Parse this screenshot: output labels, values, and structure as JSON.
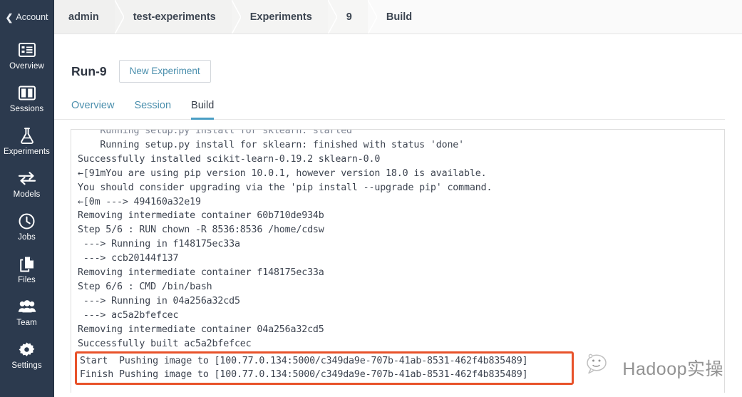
{
  "colors": {
    "sidebar_bg": "#2c3a4e",
    "accent_link": "#4b8fad",
    "tab_active_underline": "#4a9ec4",
    "highlight_box": "#e8522a",
    "text_primary": "#3d4450",
    "panel_border": "#dddddd"
  },
  "sidebar": {
    "account": {
      "label": "Account",
      "back_icon": "chevron-left-icon"
    },
    "items": [
      {
        "label": "Overview",
        "icon": "list-overview-icon"
      },
      {
        "label": "Sessions",
        "icon": "columns-sessions-icon"
      },
      {
        "label": "Experiments",
        "icon": "flask-experiments-icon"
      },
      {
        "label": "Models",
        "icon": "arrows-exchange-models-icon"
      },
      {
        "label": "Jobs",
        "icon": "clock-jobs-icon"
      },
      {
        "label": "Files",
        "icon": "copy-files-icon"
      },
      {
        "label": "Team",
        "icon": "people-team-icon"
      },
      {
        "label": "Settings",
        "icon": "gear-settings-icon"
      }
    ]
  },
  "breadcrumb": {
    "items": [
      {
        "label": "admin"
      },
      {
        "label": "test-experiments"
      },
      {
        "label": "Experiments"
      },
      {
        "label": "9"
      },
      {
        "label": "Build"
      }
    ]
  },
  "main": {
    "run_title": "Run-9",
    "new_experiment_button": "New Experiment",
    "tabs": [
      {
        "label": "Overview",
        "active": false
      },
      {
        "label": "Session",
        "active": false
      },
      {
        "label": "Build",
        "active": true
      }
    ]
  },
  "build_log": {
    "clipped_top_line": "    Running setup.py install for sklearn: started",
    "lines": [
      "    Running setup.py install for sklearn: finished with status 'done'",
      "Successfully installed scikit-learn-0.19.2 sklearn-0.0",
      "←[91mYou are using pip version 10.0.1, however version 18.0 is available.",
      "You should consider upgrading via the 'pip install --upgrade pip' command.",
      "←[0m ---> 494160a32e19",
      "Removing intermediate container 60b710de934b",
      "Step 5/6 : RUN chown -R 8536:8536 /home/cdsw",
      " ---> Running in f148175ec33a",
      " ---> ccb20144f137",
      "Removing intermediate container f148175ec33a",
      "Step 6/6 : CMD /bin/bash",
      " ---> Running in 04a256a32cd5",
      " ---> ac5a2bfefcec",
      "Removing intermediate container 04a256a32cd5",
      "Successfully built ac5a2bfefcec"
    ],
    "highlighted_lines": [
      "Start  Pushing image to [100.77.0.134:5000/c349da9e-707b-41ab-8531-462f4b835489]",
      "Finish Pushing image to [100.77.0.134:5000/c349da9e-707b-41ab-8531-462f4b835489]"
    ]
  },
  "watermark": {
    "text": "Hadoop实操",
    "icon": "wechat-chat-icon"
  }
}
